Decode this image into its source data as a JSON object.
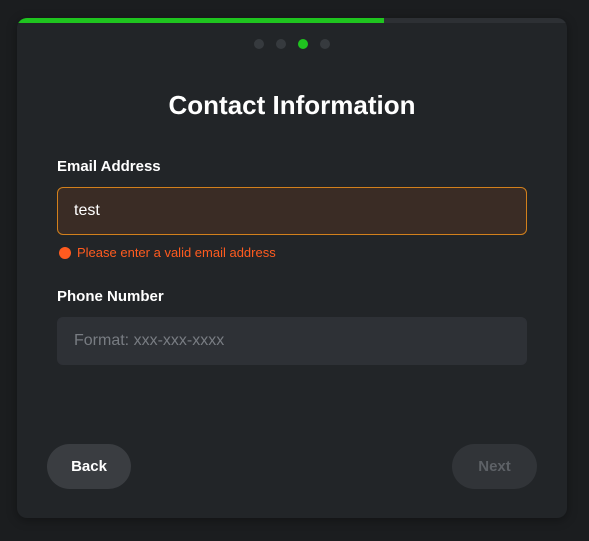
{
  "wizard": {
    "progress_fraction": 0.667,
    "steps_total": 4,
    "active_step": 3,
    "title": "Contact Information"
  },
  "form": {
    "email": {
      "label": "Email Address",
      "value": "test",
      "error": "Please enter a valid email address"
    },
    "phone": {
      "label": "Phone Number",
      "value": "",
      "placeholder": "Format: xxx-xxx-xxxx"
    }
  },
  "buttons": {
    "back_label": "Back",
    "next_label": "Next"
  },
  "colors": {
    "accent": "#1fc41f",
    "error": "#ff5b1f",
    "input_error_border": "#d2801c"
  },
  "icons": {
    "error": "error-circle-icon"
  }
}
